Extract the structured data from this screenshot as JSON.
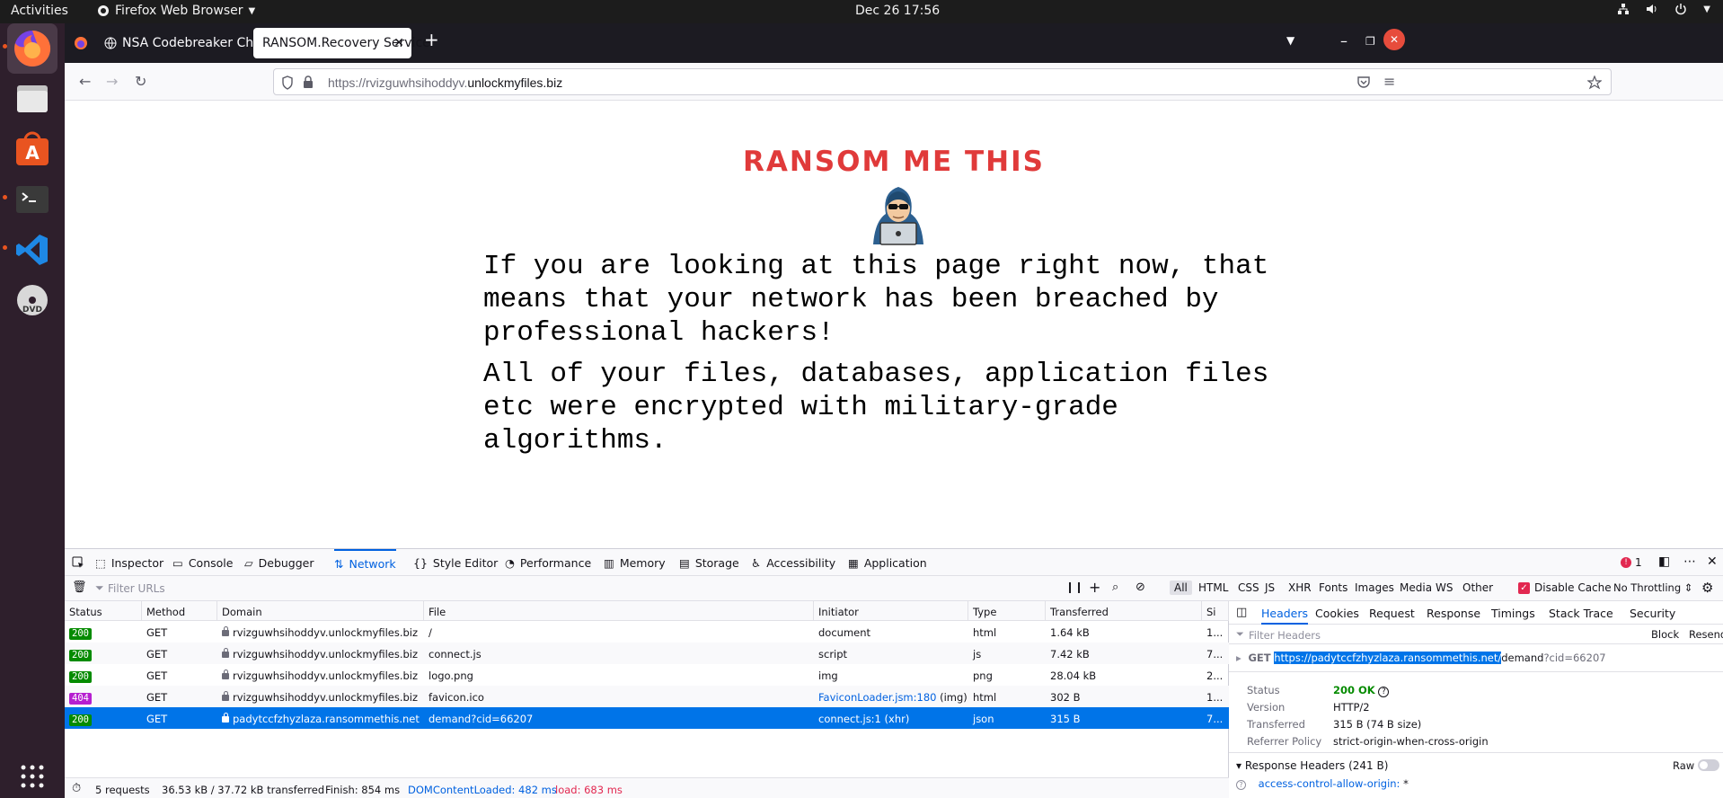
{
  "topbar": {
    "activities": "Activities",
    "app_name": "Firefox Web Browser",
    "clock": "Dec 26  17:56"
  },
  "browser": {
    "tabs": [
      {
        "label": "NSA Codebreaker Challe"
      },
      {
        "label": "RANSOM.Recovery Service"
      }
    ],
    "url_prefix": "https://rvizguwhsihoddyv.",
    "url_domain": "unlockmyfiles.biz"
  },
  "page": {
    "title": "RANSOM ME THIS",
    "paragraph1": "If you are looking at this page right now, that means that your network has been breached by professional hackers!",
    "paragraph2": "All of your files, databases, application files etc were encrypted with military-grade algorithms."
  },
  "devtools": {
    "tabs": [
      "Inspector",
      "Console",
      "Debugger",
      "Network",
      "Style Editor",
      "Performance",
      "Memory",
      "Storage",
      "Accessibility",
      "Application"
    ],
    "selected_tab": "Network",
    "error_count": "1",
    "filter_placeholder": "Filter URLs",
    "type_filters": [
      "All",
      "HTML",
      "CSS",
      "JS",
      "XHR",
      "Fonts",
      "Images",
      "Media",
      "WS",
      "Other"
    ],
    "disable_cache": "Disable Cache",
    "throttling": "No Throttling",
    "columns": [
      "Status",
      "Method",
      "Domain",
      "File",
      "Initiator",
      "Type",
      "Transferred",
      "Si"
    ],
    "requests": [
      {
        "status": "200",
        "method": "GET",
        "domain": "rvizguwhsihoddyv.unlockmyfiles.biz",
        "file": "/",
        "initiator": "document",
        "type": "html",
        "transferred": "1.64 kB",
        "size": "1..."
      },
      {
        "status": "200",
        "method": "GET",
        "domain": "rvizguwhsihoddyv.unlockmyfiles.biz",
        "file": "connect.js",
        "initiator": "script",
        "type": "js",
        "transferred": "7.42 kB",
        "size": "7..."
      },
      {
        "status": "200",
        "method": "GET",
        "domain": "rvizguwhsihoddyv.unlockmyfiles.biz",
        "file": "logo.png",
        "initiator": "img",
        "type": "png",
        "transferred": "28.04 kB",
        "size": "2..."
      },
      {
        "status": "404",
        "method": "GET",
        "domain": "rvizguwhsihoddyv.unlockmyfiles.biz",
        "file": "favicon.ico",
        "initiator": "FaviconLoader.jsm:180",
        "initiator_suffix": "(img)",
        "type": "html",
        "transferred": "302 B",
        "size": "1..."
      },
      {
        "status": "200",
        "method": "GET",
        "domain": "padytccfzhyzlaza.ransommethis.net",
        "file": "demand?cid=66207",
        "initiator": "connect.js:1 (xhr)",
        "type": "json",
        "transferred": "315 B",
        "size": "7..."
      }
    ],
    "footer": {
      "requests": "5 requests",
      "transferred": "36.53 kB / 37.72 kB transferred",
      "finish": "Finish: 854 ms",
      "dom_loaded": "DOMContentLoaded: 482 ms",
      "load": "load: 683 ms"
    },
    "side": {
      "tabs": [
        "Headers",
        "Cookies",
        "Request",
        "Response",
        "Timings",
        "Stack Trace",
        "Security"
      ],
      "filter_placeholder": "Filter Headers",
      "block": "Block",
      "resend": "Resend",
      "method": "GET",
      "url_selected": "https://padytccfzhyzlaza.ransommethis.net/",
      "url_rest": "demand",
      "url_query": "?cid=66207",
      "status_key": "Status",
      "status_val": "200 OK",
      "version_key": "Version",
      "version_val": "HTTP/2",
      "transferred_key": "Transferred",
      "transferred_val": "315 B (74 B size)",
      "referrer_key": "Referrer Policy",
      "referrer_val": "strict-origin-when-cross-origin",
      "response_headers": "Response Headers (241 B)",
      "raw": "Raw",
      "acao_key": "access-control-allow-origin:",
      "acao_val": "*"
    }
  },
  "colors": {
    "status_ok": "#058b00",
    "status_404": "#b61fd0",
    "selected_row": "#0074e8",
    "accent": "#0061e0",
    "logo_red": "#e03a3a"
  }
}
